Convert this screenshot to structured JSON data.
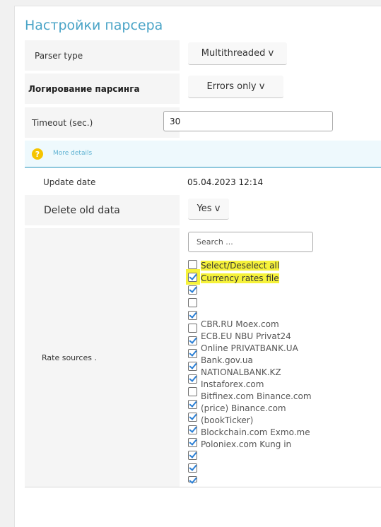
{
  "page": {
    "title": "Настройки парсера"
  },
  "form": {
    "parser_type": {
      "label": "Parser type",
      "value": "Multithreaded v"
    },
    "logging": {
      "label": "Логирование парсинга",
      "value": "Errors only v"
    },
    "timeout": {
      "label": "Timeout (sec.)",
      "value": "30"
    },
    "info": {
      "link": "More details",
      "icon": "question-icon"
    },
    "update_date": {
      "label": "Update date",
      "value": "05.04.2023 12:14"
    },
    "delete_old": {
      "label": "Delete old data",
      "value": "Yes v"
    },
    "rate_sources": {
      "label": "Rate sources .",
      "search_placeholder": "Search ...",
      "select_all": "Select/Deselect all",
      "currency_file": "Currency rates file",
      "lines": [
        "CBR.RU Moex.com",
        "ECB.EU NBU Privat24",
        "Online PRIVATBANK.UA",
        "Bank.gov.ua",
        "NATIONALBANK.KZ",
        "Instaforex.com",
        "Bitfinex.com Binance.com",
        "(price) Binance.com",
        "(bookTicker)",
        "Blockchain.com Exmo.me",
        "Poloniex.com Kung in"
      ]
    }
  },
  "colors": {
    "accent": "#4aa4c7",
    "highlight": "#f6f23a",
    "info_bg": "#eef9fd"
  }
}
